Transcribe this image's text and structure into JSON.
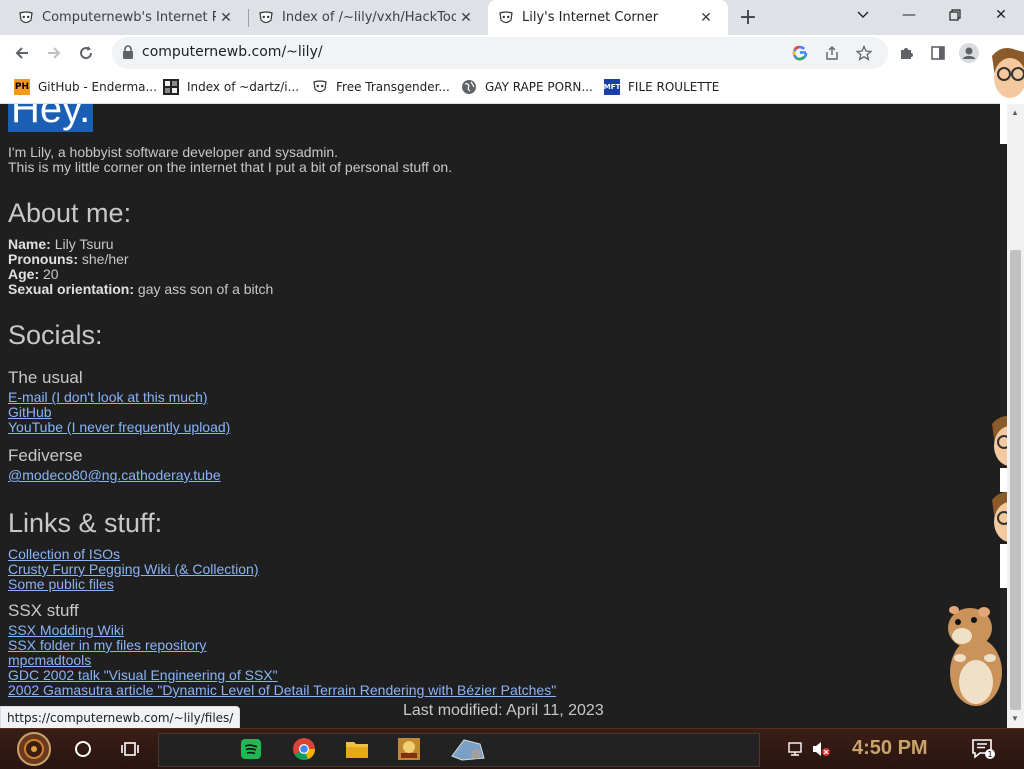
{
  "tabs": [
    {
      "title": "Computernewb's Internet Pub",
      "active": false
    },
    {
      "title": "Index of /~lily/vxh/HackTool/",
      "active": false
    },
    {
      "title": "Lily's Internet Corner",
      "active": true
    }
  ],
  "address_bar": {
    "url": "computernewb.com/~lily/"
  },
  "bookmarks": [
    {
      "label": "GitHub - Enderma...",
      "icon": "PH"
    },
    {
      "label": "Index of ~dartz/i...",
      "icon": "dartz"
    },
    {
      "label": "Free Transgender...",
      "icon": "mask"
    },
    {
      "label": "GAY RAPE PORN...",
      "icon": "globe"
    },
    {
      "label": "FILE ROULETTE",
      "icon": "MFT"
    }
  ],
  "page": {
    "hey": "Hey.",
    "intro_line1": "I'm Lily, a hobbyist software developer and sysadmin.",
    "intro_line2": "This is my little corner on the internet that I put a bit of personal stuff on.",
    "about_heading": "About me:",
    "about": [
      {
        "key": "Name:",
        "value": "Lily Tsuru"
      },
      {
        "key": "Pronouns:",
        "value": "she/her"
      },
      {
        "key": "Age:",
        "value": "20"
      },
      {
        "key": "Sexual orientation:",
        "value": "gay ass son of a bitch"
      }
    ],
    "socials_heading": "Socials:",
    "usual_heading": "The usual",
    "usual_links": [
      "E-mail (I don't look at this much)",
      "GitHub",
      "YouTube (I never frequently upload)"
    ],
    "fediverse_heading": "Fediverse",
    "fediverse_links": [
      "@modeco80@ng.cathoderay.tube"
    ],
    "links_heading": "Links & stuff:",
    "links": [
      "Collection of ISOs",
      "Crusty Furry Pegging Wiki (& Collection)",
      "Some public files"
    ],
    "ssx_heading": "SSX stuff",
    "ssx_links": [
      "SSX Modding Wiki",
      "SSX folder in my files repository",
      "mpcmadtools",
      "GDC 2002 talk \"Visual Engineering of SSX\"",
      "2002 Gamasutra article \"Dynamic Level of Detail Terrain Rendering with Bézier Patches\""
    ],
    "last_modified": "Last modified: April 11, 2023"
  },
  "status_url": "https://computernewb.com/~lily/files/",
  "taskbar": {
    "clock": "4:50 PM",
    "notification_count": "1"
  },
  "colors": {
    "page_bg": "#1f1f1f",
    "link": "#8ab4f8",
    "highlight": "#1a5fb4",
    "text": "#c8c8c8"
  }
}
